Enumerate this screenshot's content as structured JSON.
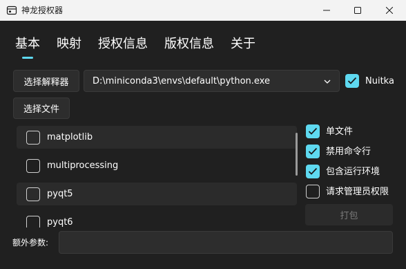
{
  "window": {
    "title": "神龙授权器"
  },
  "tabs": [
    {
      "label": "基本"
    },
    {
      "label": "映射"
    },
    {
      "label": "授权信息"
    },
    {
      "label": "版权信息"
    },
    {
      "label": "关于"
    }
  ],
  "toolbar": {
    "select_interpreter_label": "选择解释器",
    "interpreter_path": "D:\\miniconda3\\envs\\default\\python.exe",
    "nuitka_label": "Nuitka",
    "nuitka_checked": true,
    "select_file_label": "选择文件"
  },
  "modules": [
    {
      "label": "matplotlib",
      "checked": false
    },
    {
      "label": "multiprocessing",
      "checked": false
    },
    {
      "label": "pyqt5",
      "checked": false
    },
    {
      "label": "pyqt6",
      "checked": false
    }
  ],
  "options": [
    {
      "label": "单文件",
      "checked": true
    },
    {
      "label": "禁用命令行",
      "checked": true
    },
    {
      "label": "包含运行环境",
      "checked": true
    },
    {
      "label": "请求管理员权限",
      "checked": false
    }
  ],
  "pack_label": "打包",
  "extra_args": {
    "label": "额外参数:",
    "value": ""
  },
  "colors": {
    "accent": "#5ed9f0",
    "background": "#202020"
  }
}
